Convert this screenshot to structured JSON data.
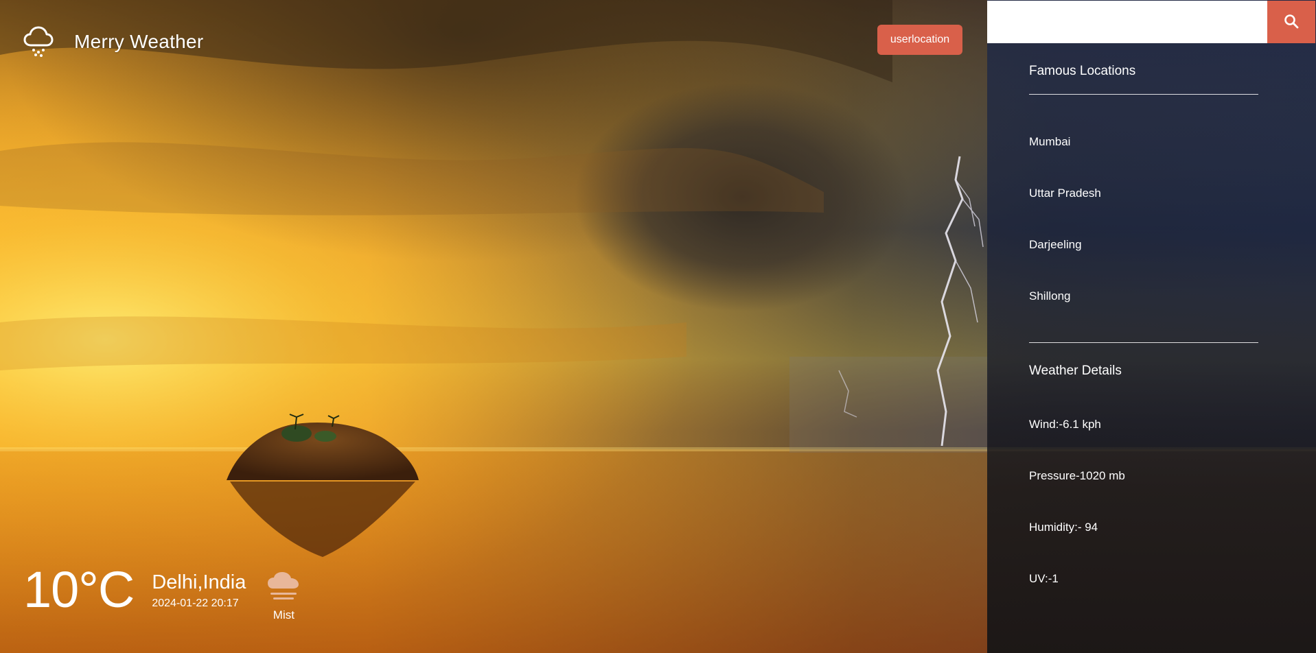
{
  "app": {
    "title": "Merry Weather",
    "icon": "cloud-snow-icon"
  },
  "header": {
    "location_button_label": "userlocation"
  },
  "search": {
    "value": "",
    "placeholder": "",
    "button_icon": "search-icon"
  },
  "current": {
    "temperature": "10°C",
    "location": "Delhi,India",
    "datetime": "2024-01-22 20:17",
    "condition": "Mist",
    "condition_icon": "mist-cloud-icon"
  },
  "famous_locations": {
    "title": "Famous Locations",
    "items": [
      "Mumbai",
      "Uttar Pradesh",
      "Darjeeling",
      "Shillong"
    ]
  },
  "weather_details": {
    "title": "Weather Details",
    "wind": "Wind:-6.1 kph",
    "pressure": "Pressure-1020 mb",
    "humidity": "Humidity:- 94",
    "uv": "UV:-1"
  },
  "colors": {
    "accent": "#d9604a",
    "text": "#ffffff"
  }
}
